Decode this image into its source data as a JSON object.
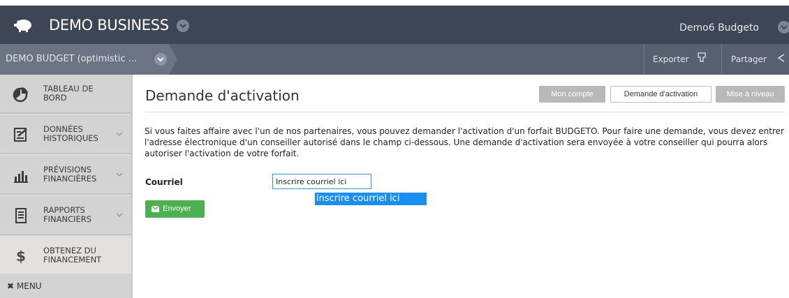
{
  "app": {
    "brand": "DEMO BUSINESS",
    "user": "Demo6 Budgeto",
    "icons": {
      "logo": "piggy-bank-icon",
      "brand_menu": "chevron-down-icon",
      "user_menu": "chevron-down-icon"
    }
  },
  "subheader": {
    "budget_name": "DEMO BUDGET (optimistic ...",
    "export_label": "Exporter",
    "share_label": "Partager"
  },
  "sidebar": {
    "items": [
      {
        "label": "TABLEAU DE BORD",
        "icon": "pie-chart-icon",
        "has_chevron": false
      },
      {
        "label": "DONNÉES HISTORIQUES",
        "icon": "edit-document-icon",
        "has_chevron": true
      },
      {
        "label": "PRÉVISIONS FINANCIÈRES",
        "icon": "bar-chart-icon",
        "has_chevron": true
      },
      {
        "label": "RAPPORTS FINANCIERS",
        "icon": "report-icon",
        "has_chevron": true
      },
      {
        "label": "OBTENEZ DU FINANCEMENT",
        "icon": "dollar-icon",
        "has_chevron": false,
        "active": true
      }
    ],
    "menu_label": "MENU"
  },
  "main": {
    "title": "Demande d'activation",
    "buttons": {
      "account": "Mon compte",
      "activation": "Demande d'activation",
      "upgrade": "Mise à niveau"
    },
    "intro": "Si vous faites affaire avec l'un de nos partenaires, vous pouvez demander l'activation d'un forfait BUDGETO. Pour faire une demande, vous devez entrer l'adresse électronique d'un conseiller autorisé dans le champ ci-dessous. Une demande d'activation sera envoyée à votre conseiller qui pourra alors autoriser l'activation de votre forfait.",
    "email_label": "Courriel",
    "email_placeholder": "Inscrire courriel ici",
    "email_value": "",
    "tooltip": "inscrire courriel ici",
    "send_label": "Envoyer"
  },
  "colors": {
    "topbar": "#3d4654",
    "subbar": "#56606f",
    "sidebar": "#d3d3d3",
    "accent_green": "#4caf50",
    "tooltip_blue": "#1a8ef0",
    "disabled_button": "#b8b8b8"
  }
}
